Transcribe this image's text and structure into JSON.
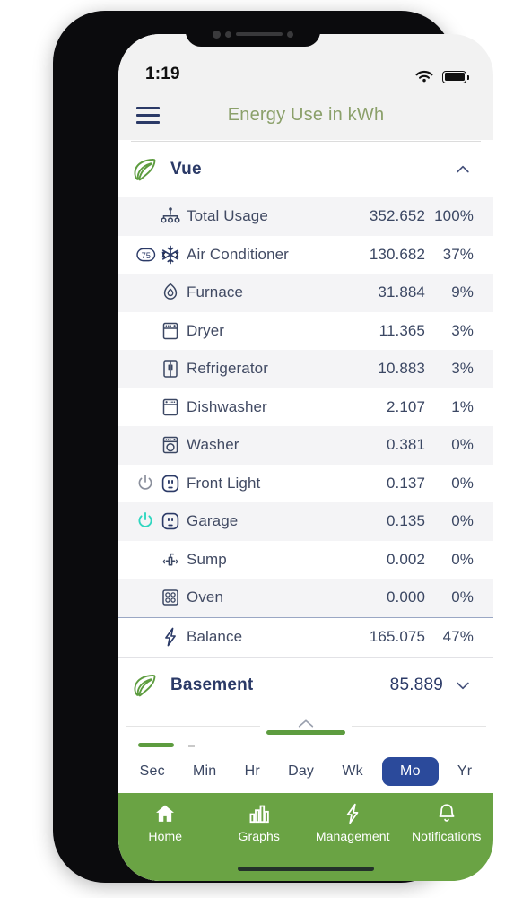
{
  "status_bar": {
    "time": "1:19",
    "wifi_icon": "wifi-icon",
    "battery_icon": "battery-full-icon"
  },
  "nav": {
    "menu_icon": "hamburger-menu-icon",
    "title": "Energy Use in kWh",
    "title_color": "#8ba06a"
  },
  "groups": [
    {
      "name": "Vue",
      "leaf_icon": "leaf-icon",
      "expanded": true,
      "chevron_icon": "chevron-up-icon",
      "value": ""
    },
    {
      "name": "Basement",
      "leaf_icon": "leaf-icon",
      "expanded": false,
      "chevron_icon": "chevron-down-icon",
      "value": "85.889"
    }
  ],
  "devices": [
    {
      "label": "Total Usage",
      "value": "352.652",
      "percent": "100%",
      "icon": "sitemap-icon",
      "power_icon": null,
      "power_on": false
    },
    {
      "label": "Air Conditioner",
      "value": "130.682",
      "percent": "37%",
      "icon": "snowflake-icon",
      "badge": "75",
      "power_on": false
    },
    {
      "label": "Furnace",
      "value": "31.884",
      "percent": "9%",
      "icon": "flame-icon",
      "power_icon": null,
      "power_on": false
    },
    {
      "label": "Dryer",
      "value": "11.365",
      "percent": "3%",
      "icon": "dryer-icon",
      "power_icon": null,
      "power_on": false
    },
    {
      "label": "Refrigerator",
      "value": "10.883",
      "percent": "3%",
      "icon": "refrigerator-icon",
      "power_icon": null,
      "power_on": false
    },
    {
      "label": "Dishwasher",
      "value": "2.107",
      "percent": "1%",
      "icon": "dishwasher-icon",
      "power_icon": null,
      "power_on": false
    },
    {
      "label": "Washer",
      "value": "0.381",
      "percent": "0%",
      "icon": "washer-icon",
      "power_icon": null,
      "power_on": false
    },
    {
      "label": "Front Light",
      "value": "0.137",
      "percent": "0%",
      "icon": "outlet-icon",
      "power_icon": "power-icon",
      "power_on": false
    },
    {
      "label": "Garage",
      "value": "0.135",
      "percent": "0%",
      "icon": "outlet-icon",
      "power_icon": "power-icon",
      "power_on": true
    },
    {
      "label": "Sump",
      "value": "0.002",
      "percent": "0%",
      "icon": "sump-pump-icon",
      "power_icon": null,
      "power_on": false
    },
    {
      "label": "Oven",
      "value": "0.000",
      "percent": "0%",
      "icon": "stovetop-icon",
      "power_icon": null,
      "power_on": false
    }
  ],
  "balance": {
    "label": "Balance",
    "value": "165.075",
    "percent": "47%",
    "icon": "bolt-icon"
  },
  "sheet": {
    "caret_icon": "chevron-up-icon",
    "grip": "drag-handle"
  },
  "time_scales": [
    {
      "label": "Sec",
      "active": false
    },
    {
      "label": "Min",
      "active": false
    },
    {
      "label": "Hr",
      "active": false
    },
    {
      "label": "Day",
      "active": false
    },
    {
      "label": "Wk",
      "active": false
    },
    {
      "label": "Mo",
      "active": true
    },
    {
      "label": "Yr",
      "active": false
    }
  ],
  "tabs": [
    {
      "label": "Home",
      "icon": "home-icon",
      "active": true
    },
    {
      "label": "Graphs",
      "icon": "bar-chart-icon",
      "active": false
    },
    {
      "label": "Management",
      "icon": "bolt-icon",
      "active": false
    },
    {
      "label": "Notifications",
      "icon": "bell-icon",
      "active": false
    }
  ],
  "colors": {
    "brand_green": "#6aa344",
    "leaf_green": "#5d9c3f",
    "navy": "#2b3a67",
    "accent_blue": "#2b4a9b",
    "power_on_teal": "#2fd6c0",
    "power_off_gray": "#8a8f9c"
  }
}
